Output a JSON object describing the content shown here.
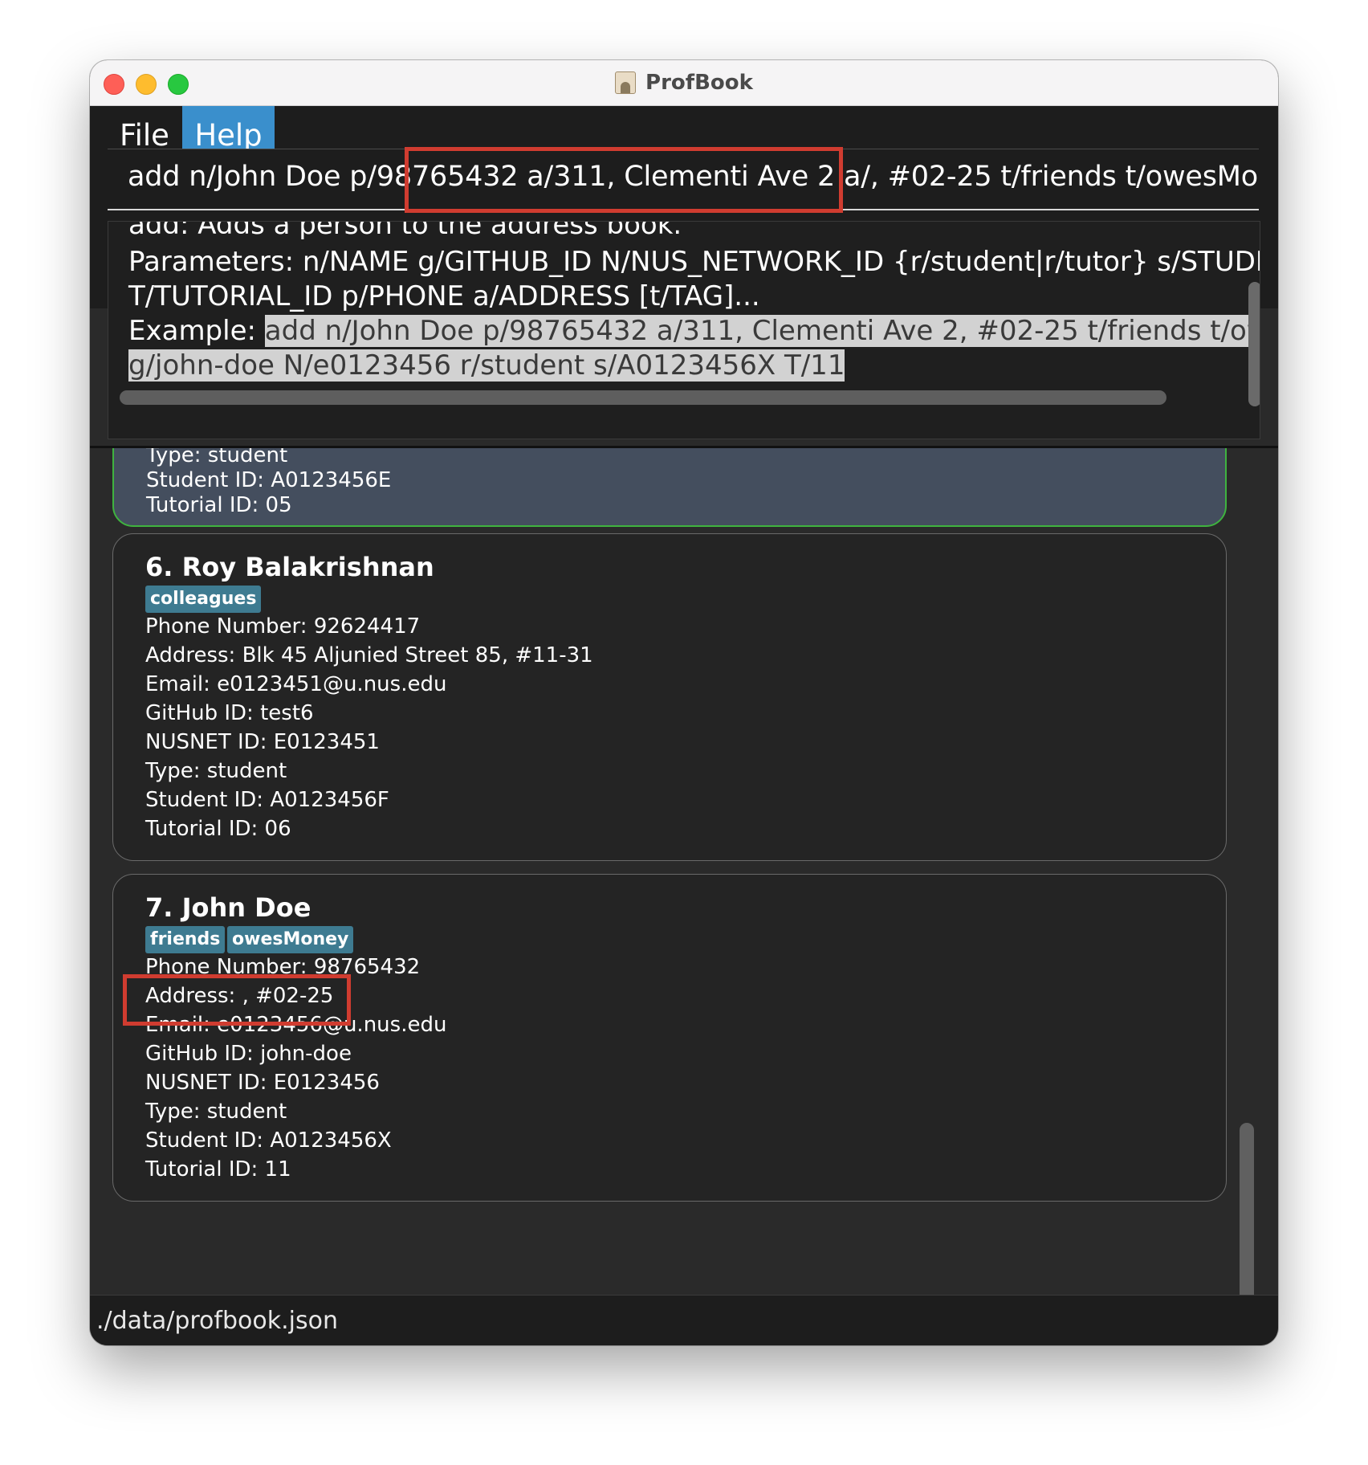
{
  "window": {
    "title": "ProfBook"
  },
  "menu": {
    "file": "File",
    "help": "Help"
  },
  "command_input": {
    "value": "add n/John Doe p/98765432 a/311, Clementi Ave 2 a/, #02-25 t/friends t/owesMoney g/jo"
  },
  "result_display": {
    "line0": "add: Adds a person to the address book.",
    "line1": "Parameters: n/NAME g/GITHUB_ID N/NUS_NETWORK_ID {r/student|r/tutor} s/STUDENT_",
    "line2": "T/TUTORIAL_ID p/PHONE a/ADDRESS [t/TAG]...",
    "line3_label": "Example: ",
    "line3_selected": "add n/John Doe p/98765432 a/311, Clementi Ave 2, #02-25 t/friends t/owesMo",
    "line4_selected": "g/john-doe N/e0123456 r/student s/A0123456X T/11"
  },
  "person_list": {
    "partial_card": {
      "type": "Type: student",
      "student_id": "Student ID: A0123456E",
      "tutorial_id": "Tutorial ID: 05"
    },
    "cards": [
      {
        "name": "6.  Roy Balakrishnan",
        "tags": [
          "colleagues"
        ],
        "phone": "Phone Number: 92624417",
        "address": "Address: Blk 45 Aljunied Street 85, #11-31",
        "email": "Email: e0123451@u.nus.edu",
        "github": "GitHub ID: test6",
        "nusnet": "NUSNET ID: E0123451",
        "type": "Type: student",
        "student_id": "Student ID: A0123456F",
        "tutorial_id": "Tutorial ID: 06"
      },
      {
        "name": "7.  John Doe",
        "tags": [
          "friends",
          "owesMoney"
        ],
        "phone": "Phone Number: 98765432",
        "address": "Address: , #02-25",
        "email": "Email: e0123456@u.nus.edu",
        "github": "GitHub ID: john-doe",
        "nusnet": "NUSNET ID: E0123456",
        "type": "Type: student",
        "student_id": "Student ID: A0123456X",
        "tutorial_id": "Tutorial ID: 11"
      }
    ]
  },
  "status_bar": {
    "path": "./data/profbook.json"
  },
  "colors": {
    "accent_menu": "#3a8fcc",
    "highlight_annotation": "#d03c30",
    "selected_card_border": "#3fb33f",
    "tag_background": "#3e7b91"
  }
}
